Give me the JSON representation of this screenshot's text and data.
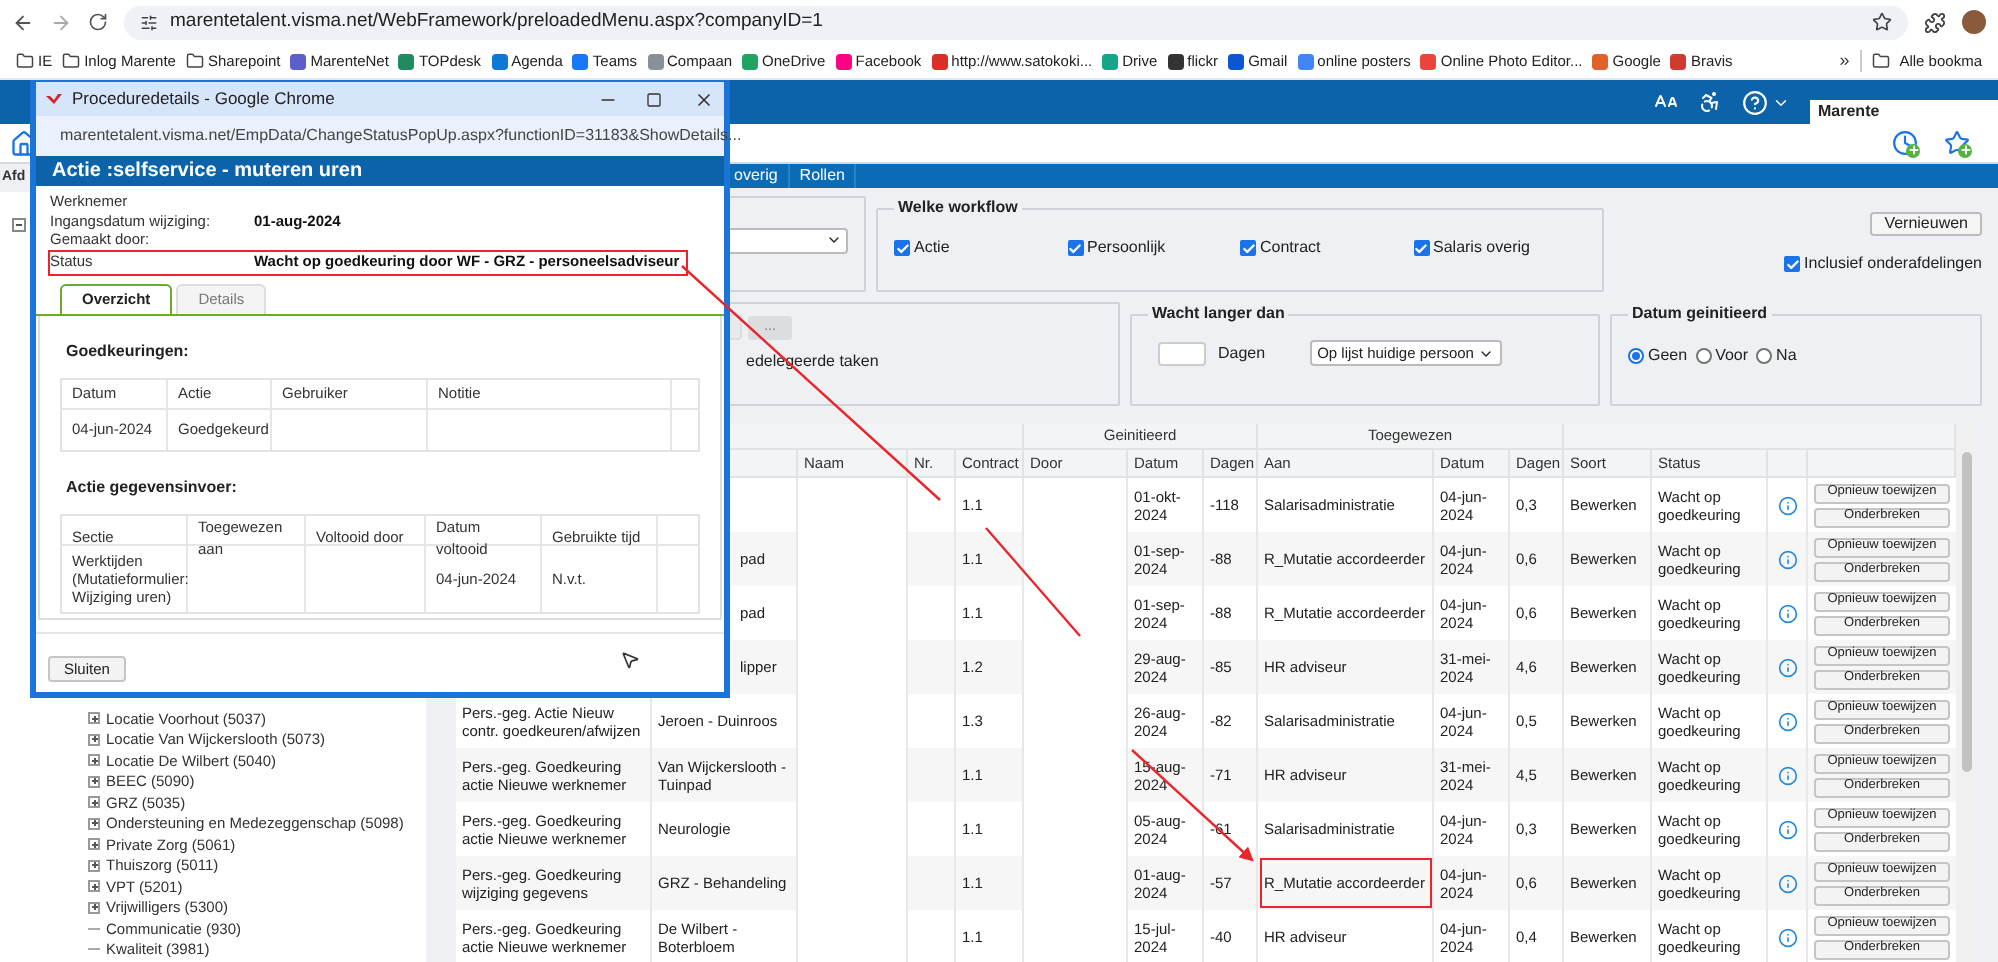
{
  "browser": {
    "url": "marentetalent.visma.net/WebFramework/preloadedMenu.aspx?companyID=1",
    "bookmarks": [
      {
        "label": "IE",
        "kind": "folder"
      },
      {
        "label": "Inlog Marente",
        "kind": "folder"
      },
      {
        "label": "Sharepoint",
        "kind": "folder"
      },
      {
        "label": "MarenteNet",
        "kind": "site"
      },
      {
        "label": "TOPdesk",
        "kind": "site"
      },
      {
        "label": "Agenda",
        "kind": "site"
      },
      {
        "label": "Teams",
        "kind": "site"
      },
      {
        "label": "Compaan",
        "kind": "site"
      },
      {
        "label": "OneDrive",
        "kind": "site"
      },
      {
        "label": "Facebook",
        "kind": "site"
      },
      {
        "label": "http://www.satokoki...",
        "kind": "site"
      },
      {
        "label": "Drive",
        "kind": "site"
      },
      {
        "label": "flickr",
        "kind": "site"
      },
      {
        "label": "Gmail",
        "kind": "site"
      },
      {
        "label": "online posters",
        "kind": "site"
      },
      {
        "label": "Online Photo Editor...",
        "kind": "site"
      },
      {
        "label": "Google",
        "kind": "site"
      },
      {
        "label": "Bravis",
        "kind": "site"
      }
    ],
    "overflow": "»",
    "all_bookmarks": "Alle bookma"
  },
  "app": {
    "user": "Marente",
    "menu": [
      "overig",
      "Rollen"
    ]
  },
  "tree": {
    "header": "Afd",
    "kind": "expanded",
    "children": [
      {
        "label": "Locatie Voorhout (5037)",
        "kind": "collapsed"
      },
      {
        "label": "Locatie Van Wijckerslooth (5073)",
        "kind": "collapsed"
      },
      {
        "label": "Locatie De Wilbert (5040)",
        "kind": "collapsed"
      },
      {
        "label": "BEEC (5090)",
        "kind": "collapsed"
      },
      {
        "label": "GRZ (5035)",
        "kind": "collapsed"
      },
      {
        "label": "Ondersteuning en Medezeggenschap (5098)",
        "kind": "collapsed"
      },
      {
        "label": "Private Zorg (5061)",
        "kind": "collapsed"
      },
      {
        "label": "Thuiszorg (5011)",
        "kind": "collapsed"
      },
      {
        "label": "VPT (5201)",
        "kind": "collapsed"
      },
      {
        "label": "Vrijwilligers (5300)",
        "kind": "collapsed"
      },
      {
        "label": "Communicatie (930)",
        "kind": "leaf"
      },
      {
        "label": "Kwaliteit (3981)",
        "kind": "leaf"
      }
    ]
  },
  "filters": {
    "workflow": {
      "title": "Welke workflow",
      "options": [
        {
          "label": "Actie",
          "checked": true
        },
        {
          "label": "Persoonlijk",
          "checked": true
        },
        {
          "label": "Contract",
          "checked": true
        },
        {
          "label": "Salaris overig",
          "checked": true
        }
      ]
    },
    "refresh_button": "Vernieuwen",
    "include_sub": {
      "label": "Inclusief onderafdelingen",
      "checked": true
    },
    "delegated": {
      "button": "...",
      "label": "edelegeerde taken"
    },
    "waiting": {
      "title": "Wacht langer dan",
      "unit": "Dagen",
      "select": "Op lijst huidige persoon"
    },
    "date": {
      "title": "Datum geinitieerd",
      "options": [
        {
          "label": "Geen",
          "selected": true
        },
        {
          "label": "Voor",
          "selected": false
        },
        {
          "label": "Na",
          "selected": false
        }
      ]
    }
  },
  "table": {
    "groups": [
      "Geinitieerd",
      "Toegewezen"
    ],
    "columns": [
      "Naam",
      "Nr.",
      "Contract",
      "Door",
      "Datum",
      "Dagen",
      "Aan",
      "Datum",
      "Dagen",
      "Soort",
      "Status"
    ],
    "rows": [
      {
        "contract": "1.1",
        "date": "01-okt-2024",
        "days": "-118",
        "assignee": "Salarisadministratie",
        "assigned_date": "04-jun-2024",
        "assigned_days": "0,3",
        "type": "Bewerken",
        "status": "Wacht op goedkeuring",
        "actions": [
          "Opnieuw toewijzen",
          "Onderbreken"
        ],
        "highlighted": false
      },
      {
        "column_2": "pad",
        "contract": "1.1",
        "date": "01-sep-2024",
        "days": "-88",
        "assignee": "R_Mutatie accordeerder",
        "assigned_date": "04-jun-2024",
        "assigned_days": "0,6",
        "type": "Bewerken",
        "status": "Wacht op goedkeuring",
        "actions": [
          "Opnieuw toewijzen",
          "Onderbreken"
        ],
        "clipped": true,
        "highlighted": false
      },
      {
        "column_2": "pad",
        "contract": "1.1",
        "date": "01-sep-2024",
        "days": "-88",
        "assignee": "R_Mutatie accordeerder",
        "assigned_date": "04-jun-2024",
        "assigned_days": "0,6",
        "type": "Bewerken",
        "status": "Wacht op goedkeuring",
        "actions": [
          "Opnieuw toewijzen",
          "Onderbreken"
        ],
        "clipped": true,
        "highlighted": false
      },
      {
        "column_2": "lipper",
        "contract": "1.2",
        "date": "29-aug-2024",
        "days": "-85",
        "assignee": "HR adviseur",
        "assigned_date": "31-mei-2024",
        "assigned_days": "4,6",
        "type": "Bewerken",
        "status": "Wacht op goedkeuring",
        "actions": [
          "Opnieuw toewijzen",
          "Onderbreken"
        ],
        "clipped": true,
        "highlighted": false
      },
      {
        "column_1": "Pers.-geg. Actie Nieuw contr. goedkeuren/afwijzen",
        "column_2": "Jeroen - Duinroos",
        "contract": "1.3",
        "date": "26-aug-2024",
        "days": "-82",
        "assignee": "Salarisadministratie",
        "assigned_date": "04-jun-2024",
        "assigned_days": "0,5",
        "type": "Bewerken",
        "status": "Wacht op goedkeuring",
        "actions": [
          "Opnieuw toewijzen",
          "Onderbreken"
        ],
        "clipped": false,
        "highlighted": false
      },
      {
        "column_1": "Pers.-geg. Goedkeuring actie Nieuwe werknemer",
        "column_2": "Van Wijckerslooth - Tuinpad",
        "contract": "1.1",
        "date": "15-aug-2024",
        "days": "-71",
        "assignee": "HR adviseur",
        "assigned_date": "31-mei-2024",
        "assigned_days": "4,5",
        "type": "Bewerken",
        "status": "Wacht op goedkeuring",
        "actions": [
          "Opnieuw toewijzen",
          "Onderbreken"
        ],
        "clipped": false,
        "highlighted": false
      },
      {
        "column_1": "Pers.-geg. Goedkeuring actie Nieuwe werknemer",
        "column_2": "Neurologie",
        "contract": "1.1",
        "date": "05-aug-2024",
        "days": "-61",
        "assignee": "Salarisadministratie",
        "assigned_date": "04-jun-2024",
        "assigned_days": "0,3",
        "type": "Bewerken",
        "status": "Wacht op goedkeuring",
        "actions": [
          "Opnieuw toewijzen",
          "Onderbreken"
        ],
        "clipped": false,
        "highlighted": false
      },
      {
        "column_1": "Pers.-geg. Goedkeuring wijziging gegevens",
        "column_2": "GRZ - Behandeling",
        "contract": "1.1",
        "date": "01-aug-2024",
        "days": "-57",
        "assignee": "R_Mutatie accordeerder",
        "assigned_date": "04-jun-2024",
        "assigned_days": "0,6",
        "type": "Bewerken",
        "status": "Wacht op goedkeuring",
        "actions": [
          "Opnieuw toewijzen",
          "Onderbreken"
        ],
        "clipped": false,
        "highlighted": true
      },
      {
        "column_1": "Pers.-geg. Goedkeuring actie Nieuwe werknemer",
        "column_2": "De Wilbert - Boterbloem",
        "contract": "1.1",
        "date": "15-jul-2024",
        "days": "-40",
        "assignee": "HR adviseur",
        "assigned_date": "04-jun-2024",
        "assigned_days": "0,4",
        "type": "Bewerken",
        "status": "Wacht op goedkeuring",
        "actions": [
          "Opnieuw toewijzen",
          "Onderbreken"
        ],
        "clipped": false,
        "highlighted": false
      }
    ]
  },
  "popup": {
    "title": "Proceduredetails - Google Chrome",
    "url": "marentetalent.visma.net/EmpData/ChangeStatusPopUp.aspx?functionID=31183&ShowDetails...",
    "heading": "Actie :selfservice - muteren uren",
    "fields": [
      {
        "label": "Werknemer",
        "highlighted": false
      },
      {
        "label": "Ingangsdatum wijziging:",
        "value": "01-aug-2024",
        "highlighted": false
      },
      {
        "label": "Gemaakt door:",
        "highlighted": false
      },
      {
        "label": "Status",
        "value": "Wacht op goedkeuring door WF - GRZ - personeelsadviseur",
        "highlighted": true
      }
    ],
    "tabs": [
      {
        "label": "Overzicht",
        "selected": true
      },
      {
        "label": "Details",
        "selected": false
      }
    ],
    "approvals": {
      "title": "Goedkeuringen:",
      "columns": [
        "Datum",
        "Actie",
        "Gebruiker",
        "Notitie"
      ],
      "rows": [
        [
          "04-jun-2024",
          "Goedgekeurd",
          null,
          null
        ]
      ]
    },
    "entries": {
      "title": "Actie gegevensinvoer:",
      "columns": [
        "Sectie",
        "Toegewezen aan",
        "Voltooid door",
        "Datum voltooid",
        "Gebruikte tijd"
      ],
      "rows": [
        [
          "Werktijden (Mutatieformulier: Wijziging uren)",
          null,
          null,
          "04-jun-2024",
          "N.v.t."
        ]
      ]
    },
    "close_button": "Sluiten"
  }
}
